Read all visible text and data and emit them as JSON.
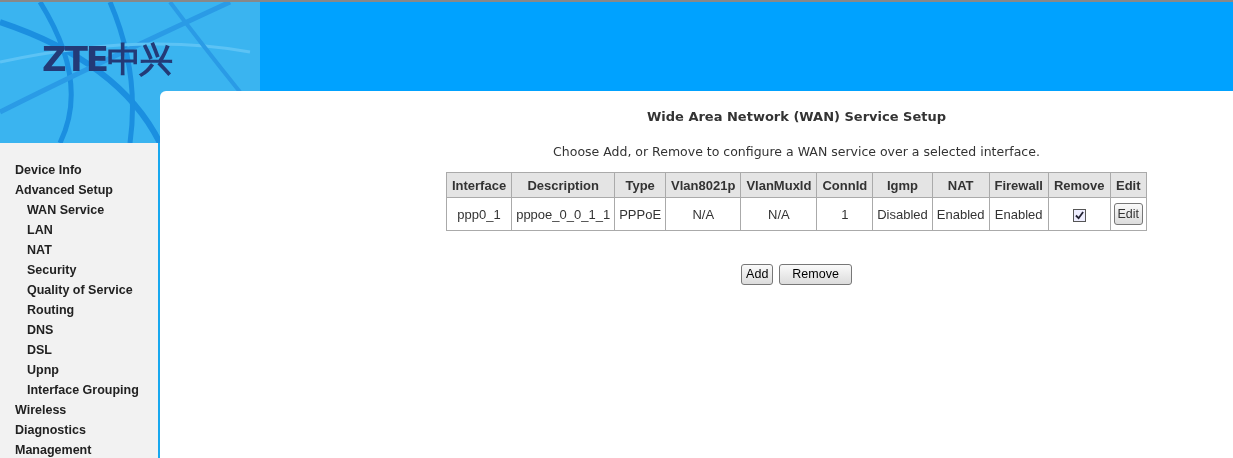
{
  "header": {
    "logo": "ZTE中兴"
  },
  "sidebar": {
    "items": [
      {
        "label": "Device Info"
      },
      {
        "label": "Advanced Setup",
        "children": [
          {
            "label": "WAN Service"
          },
          {
            "label": "LAN"
          },
          {
            "label": "NAT"
          },
          {
            "label": "Security"
          },
          {
            "label": "Quality of Service"
          },
          {
            "label": "Routing"
          },
          {
            "label": "DNS"
          },
          {
            "label": "DSL"
          },
          {
            "label": "Upnp"
          },
          {
            "label": "Interface Grouping"
          }
        ]
      },
      {
        "label": "Wireless"
      },
      {
        "label": "Diagnostics"
      },
      {
        "label": "Management"
      }
    ]
  },
  "main": {
    "title": "Wide Area Network (WAN) Service Setup",
    "description": "Choose Add, or Remove to configure a WAN service over a selected interface.",
    "table": {
      "columns": [
        "Interface",
        "Description",
        "Type",
        "Vlan8021p",
        "VlanMuxId",
        "ConnId",
        "Igmp",
        "NAT",
        "Firewall",
        "Remove",
        "Edit"
      ],
      "rows": [
        {
          "cells": [
            "ppp0_1",
            "pppoe_0_0_1_1",
            "PPPoE",
            "N/A",
            "N/A",
            "1",
            "Disabled",
            "Enabled",
            "Enabled"
          ],
          "remove_checked": true,
          "edit_label": "Edit"
        }
      ]
    },
    "buttons": [
      "Add",
      "Remove"
    ]
  }
}
